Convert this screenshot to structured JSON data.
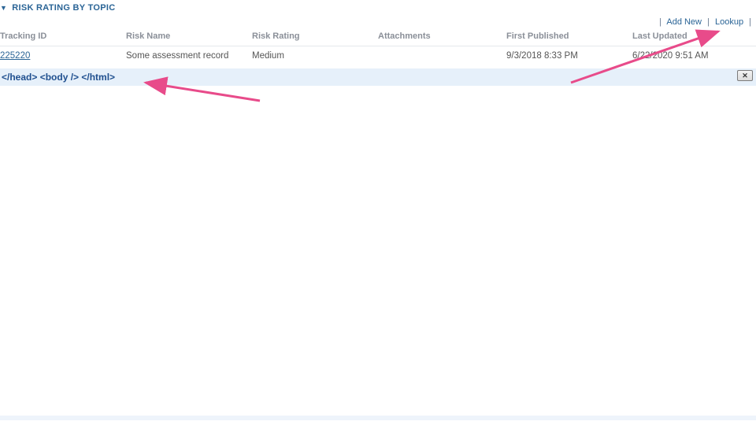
{
  "section": {
    "title": "RISK RATING BY TOPIC"
  },
  "actions": {
    "add_new": "Add New",
    "lookup": "Lookup",
    "sep": "|"
  },
  "columns": {
    "tracking": "Tracking ID",
    "riskname": "Risk Name",
    "rating": "Risk Rating",
    "attach": "Attachments",
    "first": "First Published",
    "last": "Last Updated"
  },
  "rows": [
    {
      "tracking": "225220",
      "riskname": "Some assessment record",
      "rating": "Medium",
      "attach": "",
      "first": "9/3/2018 8:33 PM",
      "last": "6/22/2020 9:51 AM"
    }
  ],
  "footer": {
    "text": "</head> <body /> </html>",
    "delete_label": "✕"
  }
}
